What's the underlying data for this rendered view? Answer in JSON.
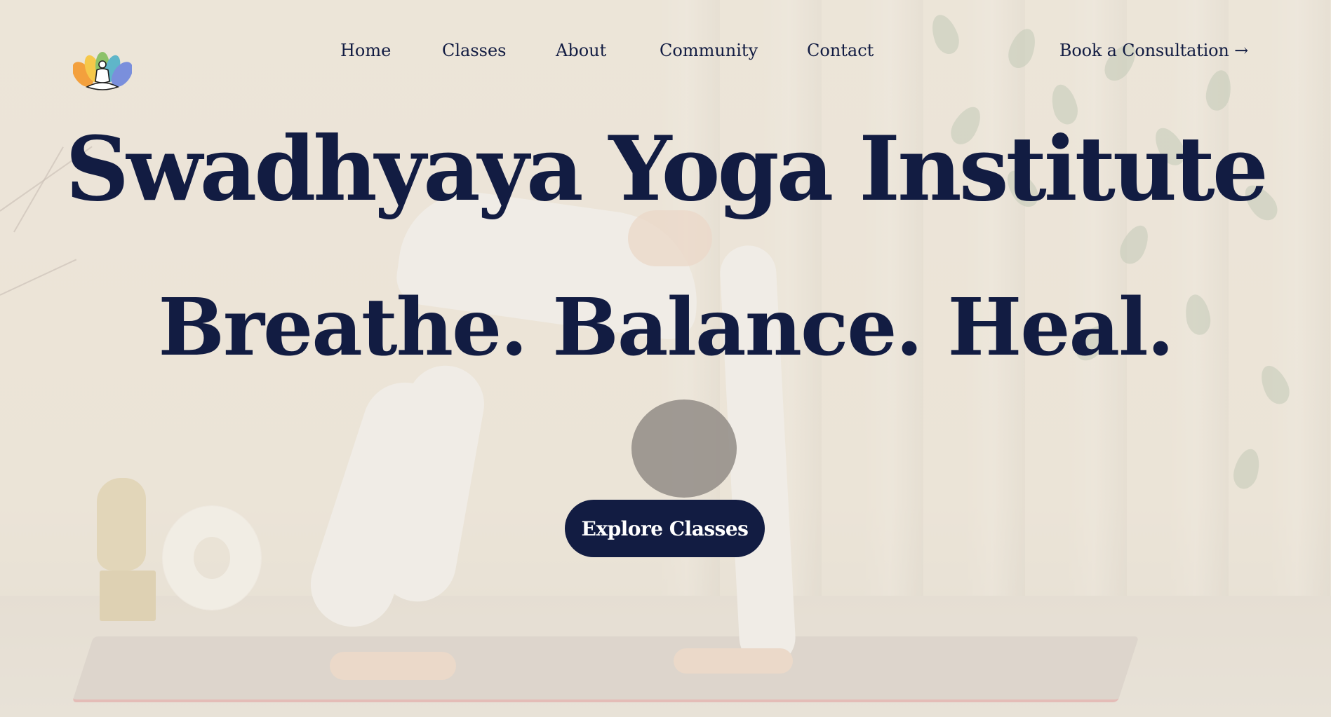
{
  "header": {
    "logo_icon": "lotus-meditation-icon",
    "nav": [
      {
        "label": "Home"
      },
      {
        "label": "Classes"
      },
      {
        "label": "About"
      },
      {
        "label": "Community"
      },
      {
        "label": "Contact"
      }
    ],
    "consult_label": "Book a Consultation →"
  },
  "hero": {
    "title": "Swadhyaya Yoga Institute",
    "tagline": "Breathe. Balance. Heal.",
    "cta_label": "Explore Classes"
  },
  "colors": {
    "brand_navy": "#121c42",
    "background": "#ebe4d8",
    "button_text": "#ffffff"
  }
}
